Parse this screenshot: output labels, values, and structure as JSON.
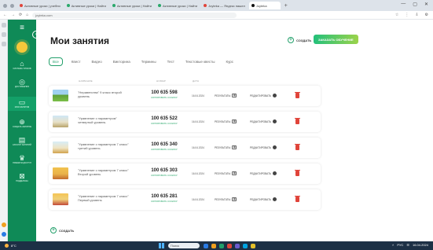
{
  "browser": {
    "tabs": [
      {
        "label": "Активные уроки | учебни",
        "color": "#e0443a",
        "active": false
      },
      {
        "label": "Активные уроки | Найти",
        "color": "#2aa86b",
        "active": false
      },
      {
        "label": "Активные уроки | Найти",
        "color": "#2aa86b",
        "active": false
      },
      {
        "label": "Активные уроки | Найти",
        "color": "#2aa86b",
        "active": false
      },
      {
        "label": "Joyteka — Яндекс нашел",
        "color": "#e0443a",
        "active": false
      },
      {
        "label": "Joyteka",
        "color": "#111111",
        "active": true
      }
    ],
    "new_tab": "+",
    "url": "joyteka.com",
    "window_controls": [
      "—",
      "▢",
      "✕"
    ],
    "nav_buttons": [
      "←",
      "→",
      "⟳",
      "⌂"
    ],
    "right_icons": [
      "☆",
      "⋮",
      "⇩",
      "⚙"
    ]
  },
  "sidebar": {
    "hamburger": "≡",
    "collapse": "‹",
    "items": [
      {
        "icon": "⌂",
        "label": "СИСТЕМА УРОКОВ"
      },
      {
        "icon": "◎",
        "label": "ДОСТИЖЕНИЯ"
      },
      {
        "icon": "▭",
        "label": "МОИ ЗАНЯТИЯ",
        "active": true
      },
      {
        "icon": "⊕",
        "label": "СОЗДАТЬ ЗАНЯТИЕ"
      },
      {
        "icon": "▤",
        "label": "КАТАЛОГ ЗАНЯТИЙ"
      },
      {
        "icon": "♛",
        "label": "ПРЕМИУМ ДОСТУП"
      },
      {
        "icon": "⊠",
        "label": "ПОДДЕРЖКА"
      }
    ]
  },
  "page": {
    "title": "Мои занятия",
    "create_label": "СОЗДАТЬ",
    "order_button": "ЗАКАЗАТЬ ОБУЧЕНИЕ",
    "filters": [
      "Все",
      "Квест",
      "Видео",
      "Викторина",
      "Термины",
      "Тест",
      "Текстовые квесты",
      "Курс"
    ],
    "columns": {
      "name": "НАЗВАНИЕ",
      "number": "НОМЕР",
      "date": "ДАТА"
    },
    "rows": [
      {
        "name": "\"Неравенства\" 9 класс второй уровень",
        "number": "100 635 598",
        "copy": "КОПИРОВАТЬ ССЫЛКУ",
        "date": "16.04.2024",
        "results": "РЕЗУЛЬТАТЫ",
        "edit": "РЕДАКТИРОВАТЬ",
        "thumb": "linear-gradient(180deg,#9fd1f0 0%,#9fd1f0 45%,#5d9f38 45%,#7bbf49 100%)"
      },
      {
        "name": "\"Уравнение с параметром\" четвертый уровень",
        "number": "100 635 522",
        "copy": "КОПИРОВАТЬ ССЫЛКУ",
        "date": "16.04.2024",
        "results": "РЕЗУЛЬТАТЫ",
        "edit": "РЕДАКТИРОВАТЬ",
        "thumb": "linear-gradient(180deg,#cfe7f6 0%,#e8e1c8 55%,#b8a46a 100%)"
      },
      {
        "name": "\"Уравнение с параметром 7 класс\" третий уровень",
        "number": "100 635 340",
        "copy": "КОПИРОВАТЬ ССЫЛКУ",
        "date": "16.04.2024",
        "results": "РЕЗУЛЬТАТЫ",
        "edit": "РЕДАКТИРОВАТЬ",
        "thumb": "linear-gradient(180deg,#d8eef8 0%,#efe4c3 55%,#d1a24b 100%)"
      },
      {
        "name": "\"Уравнение с параметром 7 класс\" Второй уровень",
        "number": "100 635 303",
        "copy": "КОПИРОВАТЬ ССЫЛКУ",
        "date": "16.04.2024",
        "results": "РЕЗУЛЬТАТЫ",
        "edit": "РЕДАКТИРОВАТЬ",
        "thumb": "linear-gradient(180deg,#f2c24e 0%,#e9b24a 55%,#c26a2e 100%)"
      },
      {
        "name": "\"Уравнение с параметром 7 класс\" Первый уровень",
        "number": "100 635 281",
        "copy": "КОПИРОВАТЬ ССЫЛКУ",
        "date": "16.04.2024",
        "results": "РЕЗУЛЬТАТЫ",
        "edit": "РЕДАКТИРОВАТЬ",
        "thumb": "linear-gradient(180deg,#f4c455 0%,#f0d17a 50%,#c24a3a 100%)"
      }
    ],
    "create_bottom": "СОЗДАТЬ"
  },
  "taskbar": {
    "weather": "8°C",
    "search": "Поиск",
    "apps": [
      "#2a7be4",
      "#f0a020",
      "#23a06b",
      "#e0443a",
      "#6a5acd",
      "#00a3e0",
      "#e4c02a"
    ],
    "tray": [
      "˄",
      "РУС",
      "☰",
      "16.04.2024"
    ]
  },
  "colors": {
    "brand_green": "#0f8a57",
    "accent": "#23a06b",
    "danger": "#e0443a"
  }
}
